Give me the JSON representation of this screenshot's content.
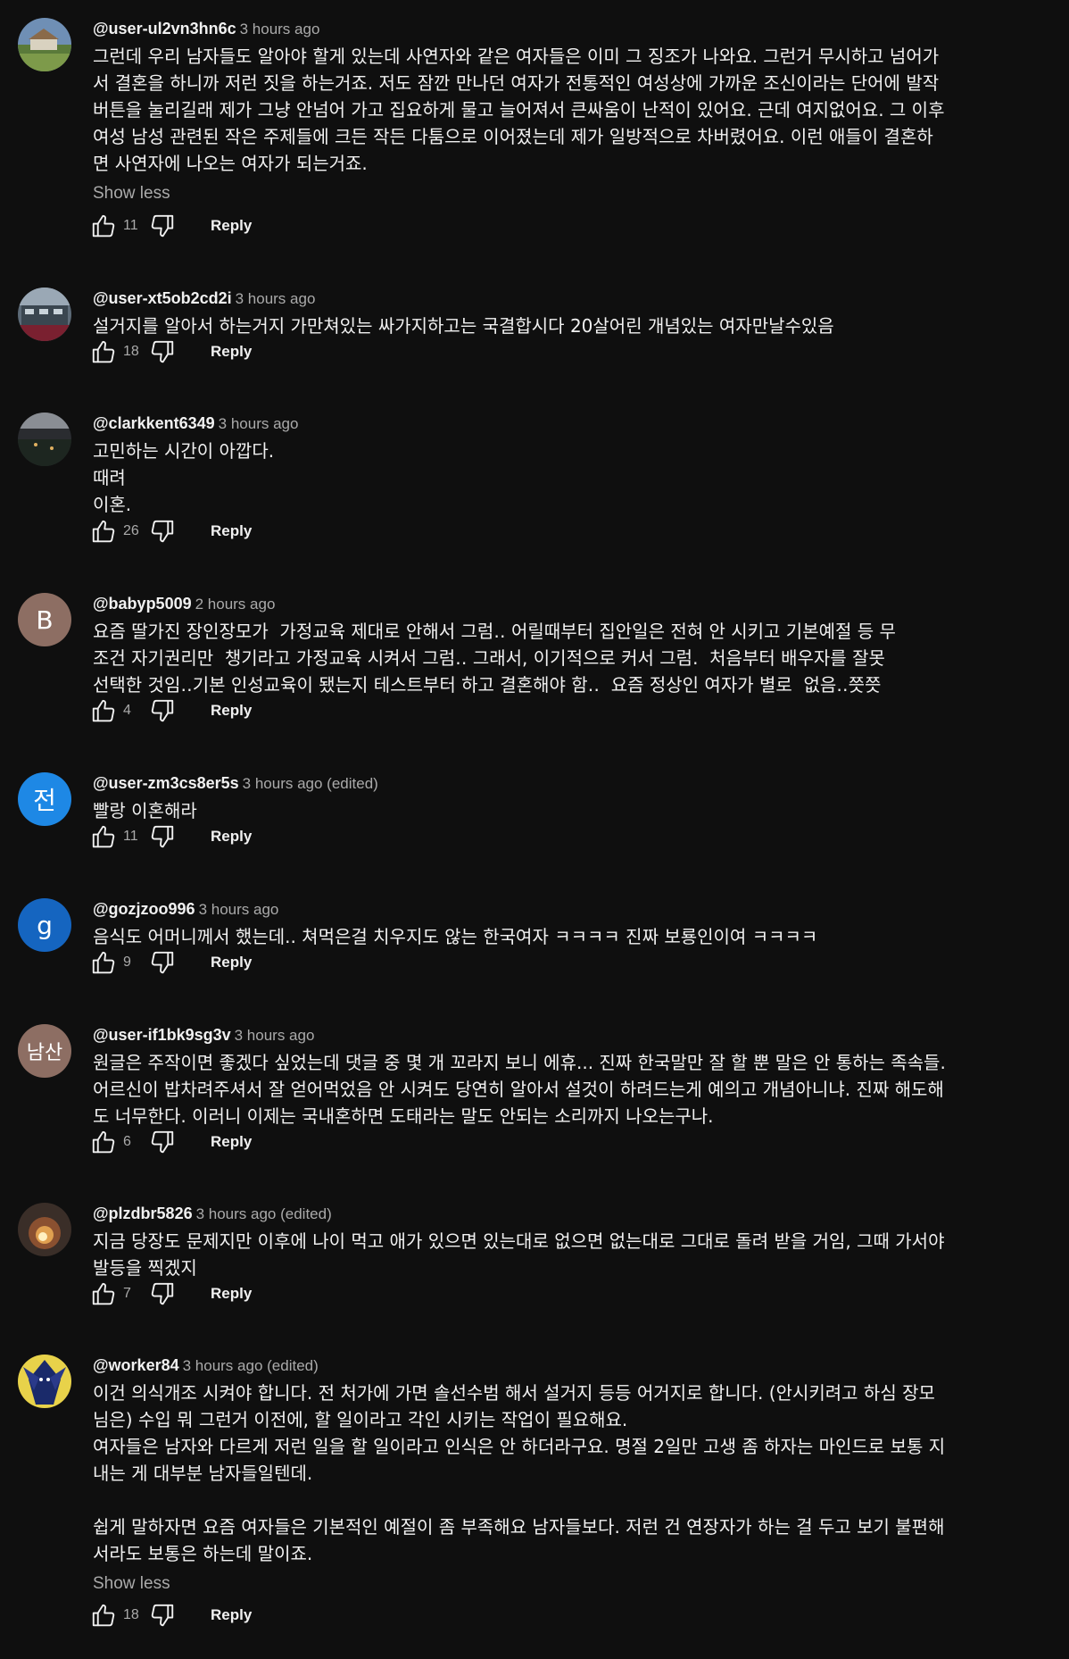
{
  "comments": [
    {
      "author": "@user-ul2vn3hn6c",
      "time": "3 hours ago",
      "avatar": {
        "type": "image",
        "icon": "landscape-avatar-icon"
      },
      "lines": [
        "그런데 우리 남자들도 알아야 할게 있는데 사연자와 같은 여자들은 이미 그 징조가 나와요. 그런거 무시하고 넘어가",
        "서 결혼을 하니까 저런 짓을 하는거죠. 저도 잠깐 만나던 여자가 전통적인 여성상에 가까운 조신이라는 단어에 발작",
        "버튼을 눌리길래 제가 그냥 안넘어 가고 집요하게 물고 늘어져서 큰싸움이 난적이 있어요. 근데 여지없어요. 그 이후",
        "여성 남성 관련된 작은 주제들에 크든 작든 다툼으로 이어졌는데 제가 일방적으로 차버렸어요. 이런 애들이 결혼하",
        "면 사연자에 나오는 여자가 되는거죠."
      ],
      "more": "Show less",
      "likes": "11",
      "reply": "Reply"
    },
    {
      "author": "@user-xt5ob2cd2i",
      "time": "3 hours ago",
      "avatar": {
        "type": "image",
        "icon": "building-avatar-icon"
      },
      "lines": [
        "설거지를 알아서 하는거지 가만쳐있는 싸가지하고는 국결합시다 20살어린 개념있는 여자만날수있음"
      ],
      "likes": "18",
      "reply": "Reply"
    },
    {
      "author": "@clarkkent6349",
      "time": "3 hours ago",
      "avatar": {
        "type": "image",
        "icon": "night-city-avatar-icon"
      },
      "lines": [
        "고민하는 시간이 아깝다.",
        "때려",
        "이혼."
      ],
      "likes": "26",
      "reply": "Reply"
    },
    {
      "author": "@babyp5009",
      "time": "2 hours ago",
      "avatar": {
        "type": "letter",
        "letter": "B",
        "color": "#8d6e63"
      },
      "lines": [
        "요즘 딸가진 장인장모가  가정교육 제대로 안해서 그럼‥ 어릴때부터 집안일은 전혀 안 시키고 기본예절 등 무",
        "조건 자기권리만  챙기라고 가정교육 시켜서 그럼‥ 그래서, 이기적으로 커서 그럼.  처음부터 배우자를 잘못",
        "선택한 것임‥기본 인성교육이 됐는지 테스트부터 하고 결혼해야 함‥  요즘 정상인 여자가 별로  없음‥쯧쯧"
      ],
      "likes": "4",
      "reply": "Reply"
    },
    {
      "author": "@user-zm3cs8er5s",
      "time": "3 hours ago (edited)",
      "avatar": {
        "type": "letter",
        "letter": "전",
        "color": "#1e88e5"
      },
      "lines": [
        "빨랑 이혼해라"
      ],
      "likes": "11",
      "reply": "Reply"
    },
    {
      "author": "@gozjzoo996",
      "time": "3 hours ago",
      "avatar": {
        "type": "letter",
        "letter": "g",
        "color": "#1565c0"
      },
      "lines": [
        "음식도 어머니께서 했는데.. 쳐먹은걸 치우지도 않는 한국여자 ㅋㅋㅋㅋ 진짜 보룡인이여 ㅋㅋㅋㅋ"
      ],
      "likes": "9",
      "reply": "Reply"
    },
    {
      "author": "@user-if1bk9sg3v",
      "time": "3 hours ago",
      "avatar": {
        "type": "letter",
        "letter": "남산",
        "color": "#8d6e63"
      },
      "lines": [
        "원글은 주작이면 좋겠다 싶었는데 댓글 중 몇 개 꼬라지 보니 에휴... 진짜 한국말만 잘 할 뿐 말은 안 통하는 족속들.",
        "어르신이 밥차려주셔서 잘 얻어먹었음 안 시켜도 당연히 알아서 설것이 하려드는게 예의고 개념아니냐. 진짜 해도해",
        "도 너무한다. 이러니 이제는 국내혼하면 도태라는 말도 안되는 소리까지 나오는구나."
      ],
      "likes": "6",
      "reply": "Reply"
    },
    {
      "author": "@plzdbr5826",
      "time": "3 hours ago (edited)",
      "avatar": {
        "type": "image",
        "icon": "explosion-avatar-icon"
      },
      "lines": [
        "지금 당장도 문제지만 이후에 나이 먹고 애가 있으면 있는대로 없으면 없는대로 그대로 돌려 받을 거임, 그때 가서야",
        "발등을 찍겠지"
      ],
      "likes": "7",
      "reply": "Reply"
    },
    {
      "author": "@worker84",
      "time": "3 hours ago (edited)",
      "avatar": {
        "type": "image",
        "icon": "character-avatar-icon"
      },
      "lines": [
        "이건 의식개조 시켜야 합니다. 전 처가에 가면 솔선수범 해서 설거지 등등 어거지로 합니다. (안시키려고 하심 장모",
        "님은) 수입 뭐 그런거 이전에, 할 일이라고 각인 시키는 작업이 필요해요.",
        "여자들은 남자와 다르게 저런 일을 할 일이라고 인식은 안 하더라구요. 명절 2일만 고생 좀 하자는 마인드로 보통 지",
        "내는 게 대부분 남자들일텐데.",
        "",
        "쉽게 말하자면 요즘 여자들은 기본적인 예절이 좀 부족해요 남자들보다. 저런 건 연장자가 하는 걸 두고 보기 불편해",
        "서라도 보통은 하는데 말이죠."
      ],
      "more": "Show less",
      "likes": "18",
      "reply": "Reply"
    }
  ],
  "icons": {
    "like": "thumbs-up-icon",
    "dislike": "thumbs-down-icon"
  },
  "colors": {
    "background": "#0f0f0f",
    "text": "#f1f1f1",
    "secondary": "#aaaaaa"
  }
}
